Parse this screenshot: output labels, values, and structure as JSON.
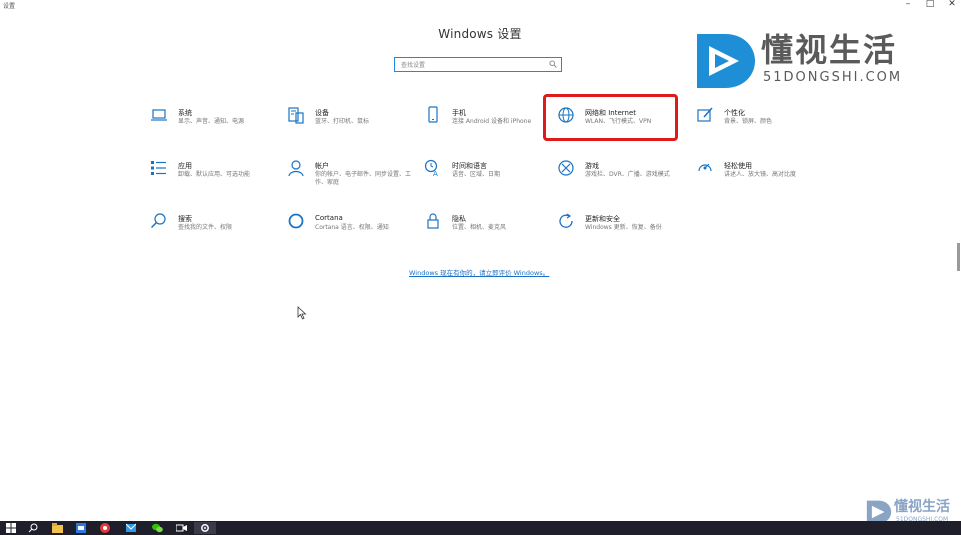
{
  "app": {
    "title": "设置"
  },
  "window_controls": {
    "minimize": "–",
    "maximize": "□",
    "close": "✕"
  },
  "header": {
    "title": "Windows 设置"
  },
  "search": {
    "placeholder": "查找设置"
  },
  "watermark": {
    "brand": "懂视生活",
    "domain": "51DONGSHI.COM",
    "accent": "#1e8fd6"
  },
  "tiles": [
    {
      "title": "系统",
      "desc": "显示、声音、通知、电源",
      "icon": "laptop-icon"
    },
    {
      "title": "设备",
      "desc": "蓝牙、打印机、鼠标",
      "icon": "keyboard-icon"
    },
    {
      "title": "手机",
      "desc": "连接 Android 设备和 iPhone",
      "icon": "phone-icon"
    },
    {
      "title": "网络和 Internet",
      "desc": "WLAN、飞行模式、VPN",
      "icon": "globe-icon"
    },
    {
      "title": "个性化",
      "desc": "背景、锁屏、颜色",
      "icon": "paint-icon"
    },
    {
      "title": "应用",
      "desc": "卸载、默认应用、可选功能",
      "icon": "apps-icon"
    },
    {
      "title": "帐户",
      "desc": "你的帐户、电子邮件、同步设置、工作、家庭",
      "icon": "person-icon"
    },
    {
      "title": "时间和语言",
      "desc": "语音、区域、日期",
      "icon": "time-language-icon"
    },
    {
      "title": "游戏",
      "desc": "游戏栏、DVR、广播、游戏模式",
      "icon": "xbox-icon"
    },
    {
      "title": "轻松使用",
      "desc": "讲述人、放大镜、高对比度",
      "icon": "ease-of-access-icon"
    },
    {
      "title": "搜索",
      "desc": "查找我的文件、权限",
      "icon": "search-icon"
    },
    {
      "title": "Cortana",
      "desc": "Cortana 语言、权限、通知",
      "icon": "cortana-icon"
    },
    {
      "title": "隐私",
      "desc": "位置、相机、麦克风",
      "icon": "lock-icon"
    },
    {
      "title": "更新和安全",
      "desc": "Windows 更新、恢复、备份",
      "icon": "update-icon"
    }
  ],
  "footer": {
    "help_link": "Windows 现在有你的，请立即评价 Windows。"
  },
  "taskbar": {
    "items": [
      "start-icon",
      "search-icon",
      "file-explorer-icon",
      "app-icon",
      "browser-icon",
      "mail-icon",
      "wechat-icon",
      "video-icon",
      "settings-icon"
    ]
  },
  "colors": {
    "highlight": "#e0191b",
    "accent": "#1e88e5",
    "taskbar": "#1f1f2b",
    "link": "#1a6fc7"
  }
}
